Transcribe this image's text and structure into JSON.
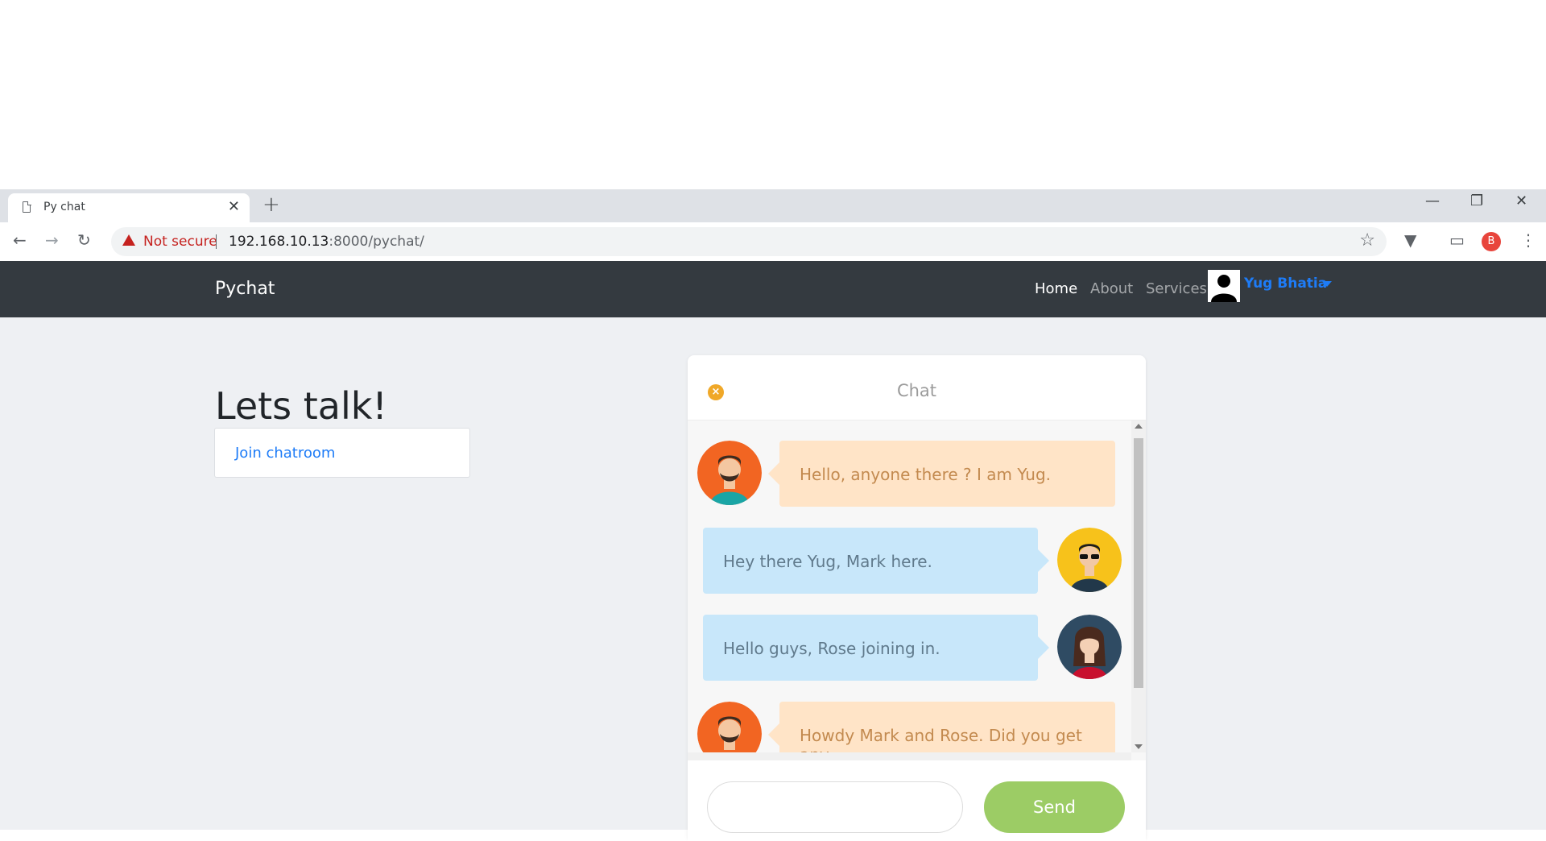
{
  "browser": {
    "tab_title": "Py chat",
    "tab_close": "✕",
    "new_tab": "+",
    "security_label": "Not secure",
    "url_host": "192.168.10.13",
    "url_path": ":8000/pychat/",
    "profile_initial": "B"
  },
  "navbar": {
    "brand": "Pychat",
    "links": [
      "Home",
      "About",
      "Services"
    ],
    "active_link": "Home",
    "user_name": "Yug Bhatia"
  },
  "page": {
    "heading": "Lets talk!",
    "join_link": "Join chatroom"
  },
  "chat": {
    "title": "Chat",
    "close_symbol": "×",
    "messages": [
      {
        "side": "left",
        "avatar": "yug-avatar",
        "text": "Hello, anyone there ? I am Yug."
      },
      {
        "side": "right",
        "avatar": "mark-avatar",
        "text": "Hey there Yug, Mark here."
      },
      {
        "side": "right",
        "avatar": "rose-avatar",
        "text": "Hello guys, Rose joining in."
      },
      {
        "side": "left",
        "avatar": "yug-avatar",
        "text": "Howdy Mark and Rose. Did you get any"
      }
    ],
    "input_placeholder": "",
    "send_label": "Send"
  },
  "colors": {
    "navbar_bg": "#343a40",
    "link_blue": "#1e7cf7",
    "send_green": "#9ccc65",
    "bubble_left": "#ffe4c7",
    "bubble_right": "#c8e7fa"
  }
}
